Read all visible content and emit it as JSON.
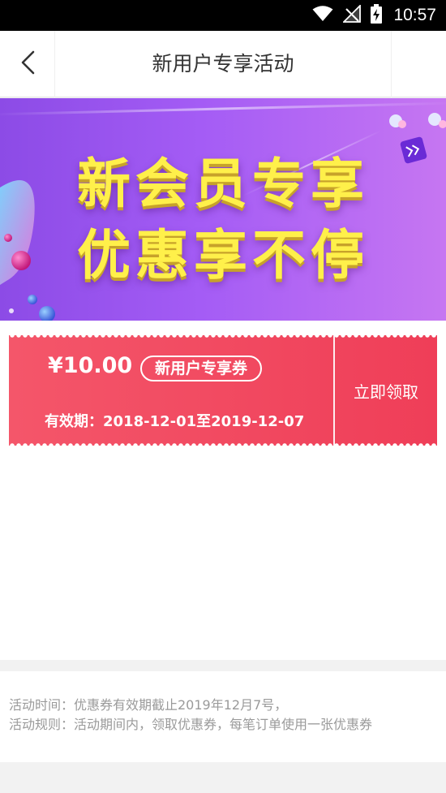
{
  "status_bar": {
    "time": "10:57",
    "icons": [
      "wifi-icon",
      "no-signal-icon",
      "battery-charging-icon"
    ]
  },
  "nav": {
    "back_icon": "chevron-left-icon",
    "title": "新用户专享活动"
  },
  "banner": {
    "line1": "新会员专享",
    "line2": "优惠享不停"
  },
  "coupon": {
    "amount": "¥10.00",
    "tag": "新用户专享券",
    "validity": "有效期：2018-12-01至2019-12-07",
    "claim_label": "立即领取",
    "color": "#f0465d"
  },
  "rules": {
    "time_text": "活动时间：优惠券有效期截止2019年12月7号，",
    "rule_text": "活动规则：活动期间内，领取优惠券，每笔订单使用一张优惠券"
  }
}
